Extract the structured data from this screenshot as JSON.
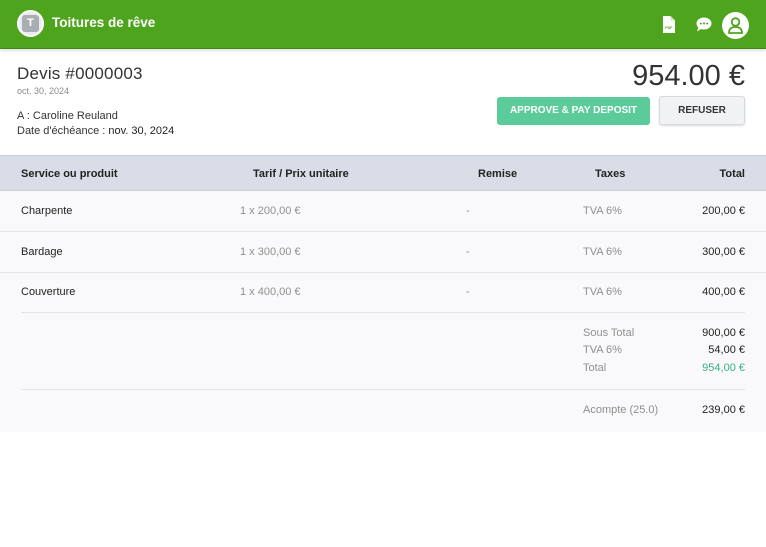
{
  "header": {
    "logo_letter": "T",
    "brand": "Toitures de rêve",
    "pdf_icon_label": "PDF"
  },
  "quote": {
    "title": "Devis #0000003",
    "date": "oct. 30, 2024",
    "to_label": "A : ",
    "to_name": "Caroline Reuland",
    "due_label": "Date d'échéance : ",
    "due_date": "nov. 30, 2024",
    "amount": "954.00 €"
  },
  "actions": {
    "approve": "APPROVE & PAY DEPOSIT",
    "refuse": "REFUSER"
  },
  "table": {
    "columns": [
      "Service ou produit",
      "Tarif / Prix unitaire",
      "Remise",
      "Taxes",
      "Total"
    ],
    "rows": [
      {
        "name": "Charpente",
        "price": "1 x 200,00 €",
        "discount": "-",
        "tax": "TVA 6%",
        "total": "200,00 €"
      },
      {
        "name": "Bardage",
        "price": "1 x 300,00 €",
        "discount": "-",
        "tax": "TVA 6%",
        "total": "300,00 €"
      },
      {
        "name": "Couverture",
        "price": "1 x 400,00 €",
        "discount": "-",
        "tax": "TVA 6%",
        "total": "400,00 €"
      }
    ]
  },
  "summary": {
    "subtotal_label": "Sous Total",
    "subtotal": "900,00 €",
    "vat_label": "TVA 6%",
    "vat": "54,00 €",
    "total_label": "Total",
    "total": "954,00 €",
    "deposit_label": "Acompte (25.0)",
    "deposit": "239,00 €"
  },
  "colors": {
    "topbar": "#4ea51d",
    "approve": "#5bcb9a",
    "total_accent": "#36b37e",
    "table_header": "#d9dde8"
  }
}
